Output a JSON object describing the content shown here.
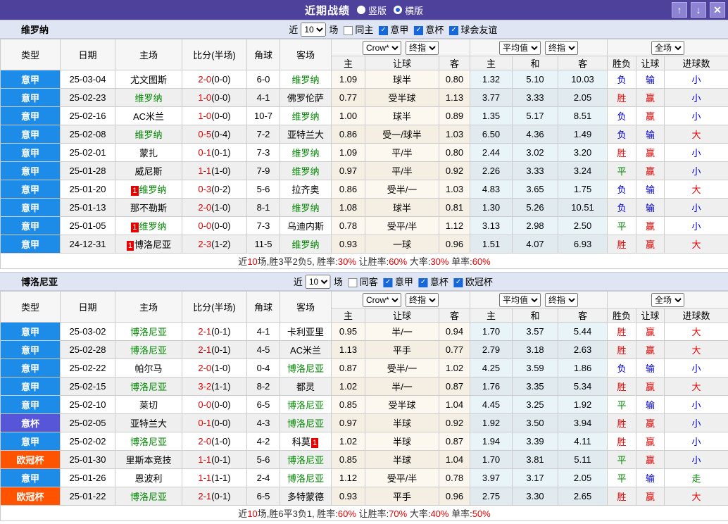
{
  "titlebar": {
    "title": "近期战绩",
    "radios": [
      {
        "label": "竖版",
        "selected": false
      },
      {
        "label": "横版",
        "selected": true
      }
    ],
    "window_buttons": [
      {
        "name": "up",
        "glyph": "↑"
      },
      {
        "name": "down",
        "glyph": "↓"
      },
      {
        "name": "close",
        "glyph": "✕"
      }
    ]
  },
  "columns": {
    "main": [
      "类型",
      "日期",
      "主场",
      "比分(半场)",
      "角球",
      "客场"
    ],
    "sub": [
      "主",
      "让球",
      "客",
      "主",
      "和",
      "客",
      "胜负",
      "让球",
      "进球数"
    ],
    "group_selects": [
      [
        "Crow*",
        "终指"
      ],
      [
        "平均值",
        "终指"
      ],
      [
        "全场"
      ]
    ]
  },
  "colors": {
    "type_badges": {
      "意甲": "#1d8ce8",
      "意杯": "#5756d8",
      "欧冠杯": "#ff5300"
    },
    "result": {
      "胜": "#e00000",
      "赢": "#e00000",
      "大": "#e00000",
      "平": "#008000",
      "走": "#008000",
      "负": "#0000cc",
      "输": "#0000cc",
      "小": "#0000cc"
    },
    "focus_team": "#008800",
    "score": "#e00000"
  },
  "sections": [
    {
      "team": "维罗纳",
      "recent_prefix": "近",
      "recent_value": "10",
      "recent_suffix": "场",
      "filters": [
        {
          "label": "同主",
          "checked": false
        },
        {
          "label": "意甲",
          "checked": true
        },
        {
          "label": "意杯",
          "checked": true
        },
        {
          "label": "球会友谊",
          "checked": true
        }
      ],
      "rows": [
        {
          "type": "意甲",
          "date": "25-03-04",
          "home": {
            "name": "尤文图斯"
          },
          "score": "2-0",
          "half": "(0-0)",
          "corners": "6-0",
          "away": {
            "name": "维罗纳",
            "focus": true
          },
          "odds": [
            "1.09",
            "球半",
            "0.80"
          ],
          "avg": [
            "1.32",
            "5.10",
            "10.03"
          ],
          "results": [
            "负",
            "输",
            "小"
          ]
        },
        {
          "type": "意甲",
          "date": "25-02-23",
          "home": {
            "name": "维罗纳",
            "focus": true
          },
          "score": "1-0",
          "half": "(0-0)",
          "corners": "4-1",
          "away": {
            "name": "佛罗伦萨"
          },
          "odds": [
            "0.77",
            "受半球",
            "1.13"
          ],
          "avg": [
            "3.77",
            "3.33",
            "2.05"
          ],
          "results": [
            "胜",
            "赢",
            "小"
          ]
        },
        {
          "type": "意甲",
          "date": "25-02-16",
          "home": {
            "name": "AC米兰"
          },
          "score": "1-0",
          "half": "(0-0)",
          "corners": "10-7",
          "away": {
            "name": "维罗纳",
            "focus": true
          },
          "odds": [
            "1.00",
            "球半",
            "0.89"
          ],
          "avg": [
            "1.35",
            "5.17",
            "8.51"
          ],
          "results": [
            "负",
            "赢",
            "小"
          ]
        },
        {
          "type": "意甲",
          "date": "25-02-08",
          "home": {
            "name": "维罗纳",
            "focus": true
          },
          "score": "0-5",
          "half": "(0-4)",
          "corners": "7-2",
          "away": {
            "name": "亚特兰大"
          },
          "odds": [
            "0.86",
            "受一/球半",
            "1.03"
          ],
          "avg": [
            "6.50",
            "4.36",
            "1.49"
          ],
          "results": [
            "负",
            "输",
            "大"
          ]
        },
        {
          "type": "意甲",
          "date": "25-02-01",
          "home": {
            "name": "蒙扎"
          },
          "score": "0-1",
          "half": "(0-1)",
          "corners": "7-3",
          "away": {
            "name": "维罗纳",
            "focus": true
          },
          "odds": [
            "1.09",
            "平/半",
            "0.80"
          ],
          "avg": [
            "2.44",
            "3.02",
            "3.20"
          ],
          "results": [
            "胜",
            "赢",
            "小"
          ]
        },
        {
          "type": "意甲",
          "date": "25-01-28",
          "home": {
            "name": "威尼斯"
          },
          "score": "1-1",
          "half": "(1-0)",
          "corners": "7-9",
          "away": {
            "name": "维罗纳",
            "focus": true
          },
          "odds": [
            "0.97",
            "平/半",
            "0.92"
          ],
          "avg": [
            "2.26",
            "3.33",
            "3.24"
          ],
          "results": [
            "平",
            "赢",
            "小"
          ]
        },
        {
          "type": "意甲",
          "date": "25-01-20",
          "home": {
            "name": "维罗纳",
            "focus": true,
            "card": "1"
          },
          "score": "0-3",
          "half": "(0-2)",
          "corners": "5-6",
          "away": {
            "name": "拉齐奥"
          },
          "odds": [
            "0.86",
            "受半/一",
            "1.03"
          ],
          "avg": [
            "4.83",
            "3.65",
            "1.75"
          ],
          "results": [
            "负",
            "输",
            "大"
          ]
        },
        {
          "type": "意甲",
          "date": "25-01-13",
          "home": {
            "name": "那不勒斯"
          },
          "score": "2-0",
          "half": "(1-0)",
          "corners": "8-1",
          "away": {
            "name": "维罗纳",
            "focus": true
          },
          "odds": [
            "1.08",
            "球半",
            "0.81"
          ],
          "avg": [
            "1.30",
            "5.26",
            "10.51"
          ],
          "results": [
            "负",
            "输",
            "小"
          ]
        },
        {
          "type": "意甲",
          "date": "25-01-05",
          "home": {
            "name": "维罗纳",
            "focus": true,
            "card": "1"
          },
          "score": "0-0",
          "half": "(0-0)",
          "corners": "7-3",
          "away": {
            "name": "乌迪内斯"
          },
          "odds": [
            "0.78",
            "受平/半",
            "1.12"
          ],
          "avg": [
            "3.13",
            "2.98",
            "2.50"
          ],
          "results": [
            "平",
            "赢",
            "小"
          ]
        },
        {
          "type": "意甲",
          "date": "24-12-31",
          "home": {
            "name": "博洛尼亚",
            "card": "1"
          },
          "score": "2-3",
          "half": "(1-2)",
          "corners": "11-5",
          "away": {
            "name": "维罗纳",
            "focus": true
          },
          "odds": [
            "0.93",
            "一球",
            "0.96"
          ],
          "avg": [
            "1.51",
            "4.07",
            "6.93"
          ],
          "results": [
            "胜",
            "赢",
            "大"
          ]
        }
      ],
      "summary": [
        [
          "近",
          "k"
        ],
        [
          "10",
          "r"
        ],
        [
          "场,胜3平2负5, 胜率:",
          "k"
        ],
        [
          "30%",
          "r"
        ],
        [
          " 让胜率:",
          "k"
        ],
        [
          "60%",
          "r"
        ],
        [
          " 大率:",
          "k"
        ],
        [
          "30%",
          "r"
        ],
        [
          " 单率:",
          "k"
        ],
        [
          "60%",
          "r"
        ]
      ]
    },
    {
      "team": "博洛尼亚",
      "recent_prefix": "近",
      "recent_value": "10",
      "recent_suffix": "场",
      "filters": [
        {
          "label": "同客",
          "checked": false
        },
        {
          "label": "意甲",
          "checked": true
        },
        {
          "label": "意杯",
          "checked": true
        },
        {
          "label": "欧冠杯",
          "checked": true
        }
      ],
      "rows": [
        {
          "type": "意甲",
          "date": "25-03-02",
          "home": {
            "name": "博洛尼亚",
            "focus": true
          },
          "score": "2-1",
          "half": "(0-1)",
          "corners": "4-1",
          "away": {
            "name": "卡利亚里"
          },
          "odds": [
            "0.95",
            "半/一",
            "0.94"
          ],
          "avg": [
            "1.70",
            "3.57",
            "5.44"
          ],
          "results": [
            "胜",
            "赢",
            "大"
          ]
        },
        {
          "type": "意甲",
          "date": "25-02-28",
          "home": {
            "name": "博洛尼亚",
            "focus": true
          },
          "score": "2-1",
          "half": "(0-1)",
          "corners": "4-5",
          "away": {
            "name": "AC米兰"
          },
          "odds": [
            "1.13",
            "平手",
            "0.77"
          ],
          "avg": [
            "2.79",
            "3.18",
            "2.63"
          ],
          "results": [
            "胜",
            "赢",
            "大"
          ]
        },
        {
          "type": "意甲",
          "date": "25-02-22",
          "home": {
            "name": "帕尔马"
          },
          "score": "2-0",
          "half": "(1-0)",
          "corners": "0-4",
          "away": {
            "name": "博洛尼亚",
            "focus": true
          },
          "odds": [
            "0.87",
            "受半/一",
            "1.02"
          ],
          "avg": [
            "4.25",
            "3.59",
            "1.86"
          ],
          "results": [
            "负",
            "输",
            "小"
          ]
        },
        {
          "type": "意甲",
          "date": "25-02-15",
          "home": {
            "name": "博洛尼亚",
            "focus": true
          },
          "score": "3-2",
          "half": "(1-1)",
          "corners": "8-2",
          "away": {
            "name": "都灵"
          },
          "odds": [
            "1.02",
            "半/一",
            "0.87"
          ],
          "avg": [
            "1.76",
            "3.35",
            "5.34"
          ],
          "results": [
            "胜",
            "赢",
            "大"
          ]
        },
        {
          "type": "意甲",
          "date": "25-02-10",
          "home": {
            "name": "莱切"
          },
          "score": "0-0",
          "half": "(0-0)",
          "corners": "6-5",
          "away": {
            "name": "博洛尼亚",
            "focus": true
          },
          "odds": [
            "0.85",
            "受半球",
            "1.04"
          ],
          "avg": [
            "4.45",
            "3.25",
            "1.92"
          ],
          "results": [
            "平",
            "输",
            "小"
          ]
        },
        {
          "type": "意杯",
          "date": "25-02-05",
          "home": {
            "name": "亚特兰大"
          },
          "score": "0-1",
          "half": "(0-0)",
          "corners": "4-3",
          "away": {
            "name": "博洛尼亚",
            "focus": true
          },
          "odds": [
            "0.97",
            "半球",
            "0.92"
          ],
          "avg": [
            "1.92",
            "3.50",
            "3.94"
          ],
          "results": [
            "胜",
            "赢",
            "小"
          ]
        },
        {
          "type": "意甲",
          "date": "25-02-02",
          "home": {
            "name": "博洛尼亚",
            "focus": true
          },
          "score": "2-0",
          "half": "(1-0)",
          "corners": "4-2",
          "away": {
            "name": "科莫",
            "card": "1"
          },
          "odds": [
            "1.02",
            "半球",
            "0.87"
          ],
          "avg": [
            "1.94",
            "3.39",
            "4.11"
          ],
          "results": [
            "胜",
            "赢",
            "小"
          ]
        },
        {
          "type": "欧冠杯",
          "date": "25-01-30",
          "home": {
            "name": "里斯本竞技"
          },
          "score": "1-1",
          "half": "(0-1)",
          "corners": "5-6",
          "away": {
            "name": "博洛尼亚",
            "focus": true
          },
          "odds": [
            "0.85",
            "半球",
            "1.04"
          ],
          "avg": [
            "1.70",
            "3.81",
            "5.11"
          ],
          "results": [
            "平",
            "赢",
            "小"
          ]
        },
        {
          "type": "意甲",
          "date": "25-01-26",
          "home": {
            "name": "恩波利"
          },
          "score": "1-1",
          "half": "(1-1)",
          "corners": "2-4",
          "away": {
            "name": "博洛尼亚",
            "focus": true
          },
          "odds": [
            "1.12",
            "受平/半",
            "0.78"
          ],
          "avg": [
            "3.97",
            "3.17",
            "2.05"
          ],
          "results": [
            "平",
            "输",
            "走"
          ]
        },
        {
          "type": "欧冠杯",
          "date": "25-01-22",
          "home": {
            "name": "博洛尼亚",
            "focus": true
          },
          "score": "2-1",
          "half": "(0-1)",
          "corners": "6-5",
          "away": {
            "name": "多特蒙德"
          },
          "odds": [
            "0.93",
            "平手",
            "0.96"
          ],
          "avg": [
            "2.75",
            "3.30",
            "2.65"
          ],
          "results": [
            "胜",
            "赢",
            "大"
          ]
        }
      ],
      "summary": [
        [
          "近",
          "k"
        ],
        [
          "10",
          "r"
        ],
        [
          "场,胜6平3负1, 胜率:",
          "k"
        ],
        [
          "60%",
          "r"
        ],
        [
          " 让胜率:",
          "k"
        ],
        [
          "70%",
          "r"
        ],
        [
          " 大率:",
          "k"
        ],
        [
          "40%",
          "r"
        ],
        [
          " 单率:",
          "k"
        ],
        [
          "50%",
          "r"
        ]
      ]
    }
  ]
}
